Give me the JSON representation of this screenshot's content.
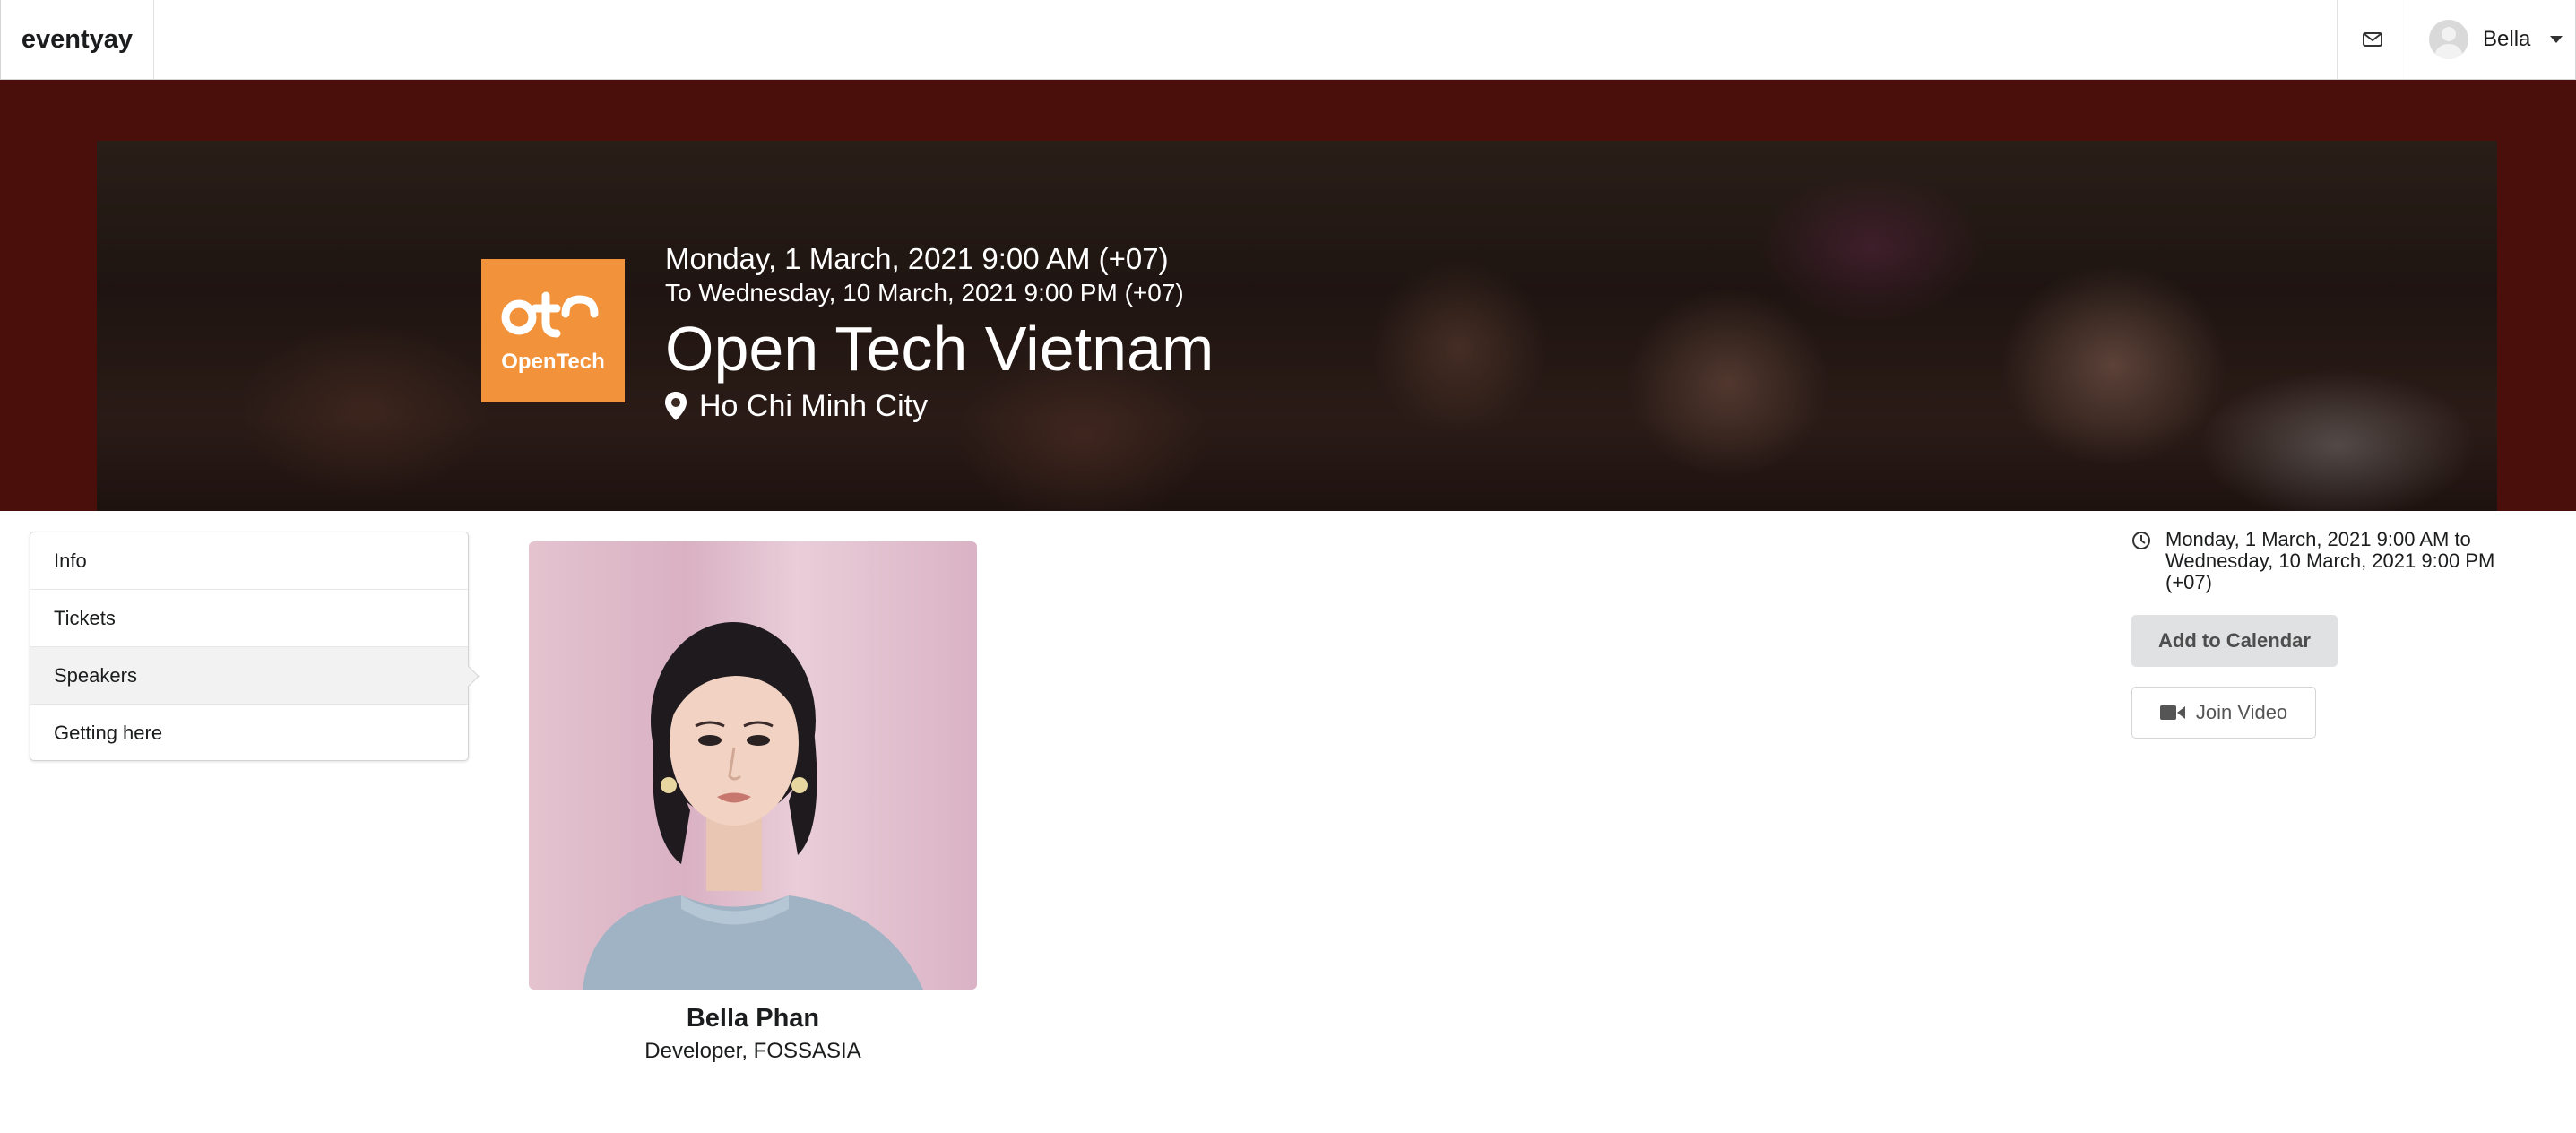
{
  "navbar": {
    "brand": "eventyay",
    "user_name": "Bella",
    "icons": {
      "mail": "mail-icon",
      "avatar": "user-avatar",
      "caret": "caret-down-icon"
    }
  },
  "hero": {
    "logo_text": "OpenTech",
    "date_start": "Monday, 1 March, 2021 9:00 AM (+07)",
    "date_end": "To Wednesday, 10 March, 2021 9:00 PM (+07)",
    "title": "Open Tech Vietnam",
    "location": "Ho Chi Minh City",
    "location_icon": "map-pin-icon",
    "colors": {
      "frame": "#4a0f0a",
      "logo_bg": "#f2923a"
    }
  },
  "menu": {
    "items": [
      {
        "label": "Info"
      },
      {
        "label": "Tickets"
      },
      {
        "label": "Speakers"
      },
      {
        "label": "Getting here"
      }
    ],
    "active": "Speakers"
  },
  "speaker": {
    "name": "Bella Phan",
    "role": "Developer, FOSSASIA"
  },
  "side": {
    "time_icon": "clock-icon",
    "time_text": "Monday, 1 March, 2021 9:00 AM to Wednesday, 10 March, 2021 9:00 PM (+07)",
    "add_calendar_label": "Add to Calendar",
    "join_video_label": "Join Video",
    "video_icon": "video-camera-icon"
  }
}
